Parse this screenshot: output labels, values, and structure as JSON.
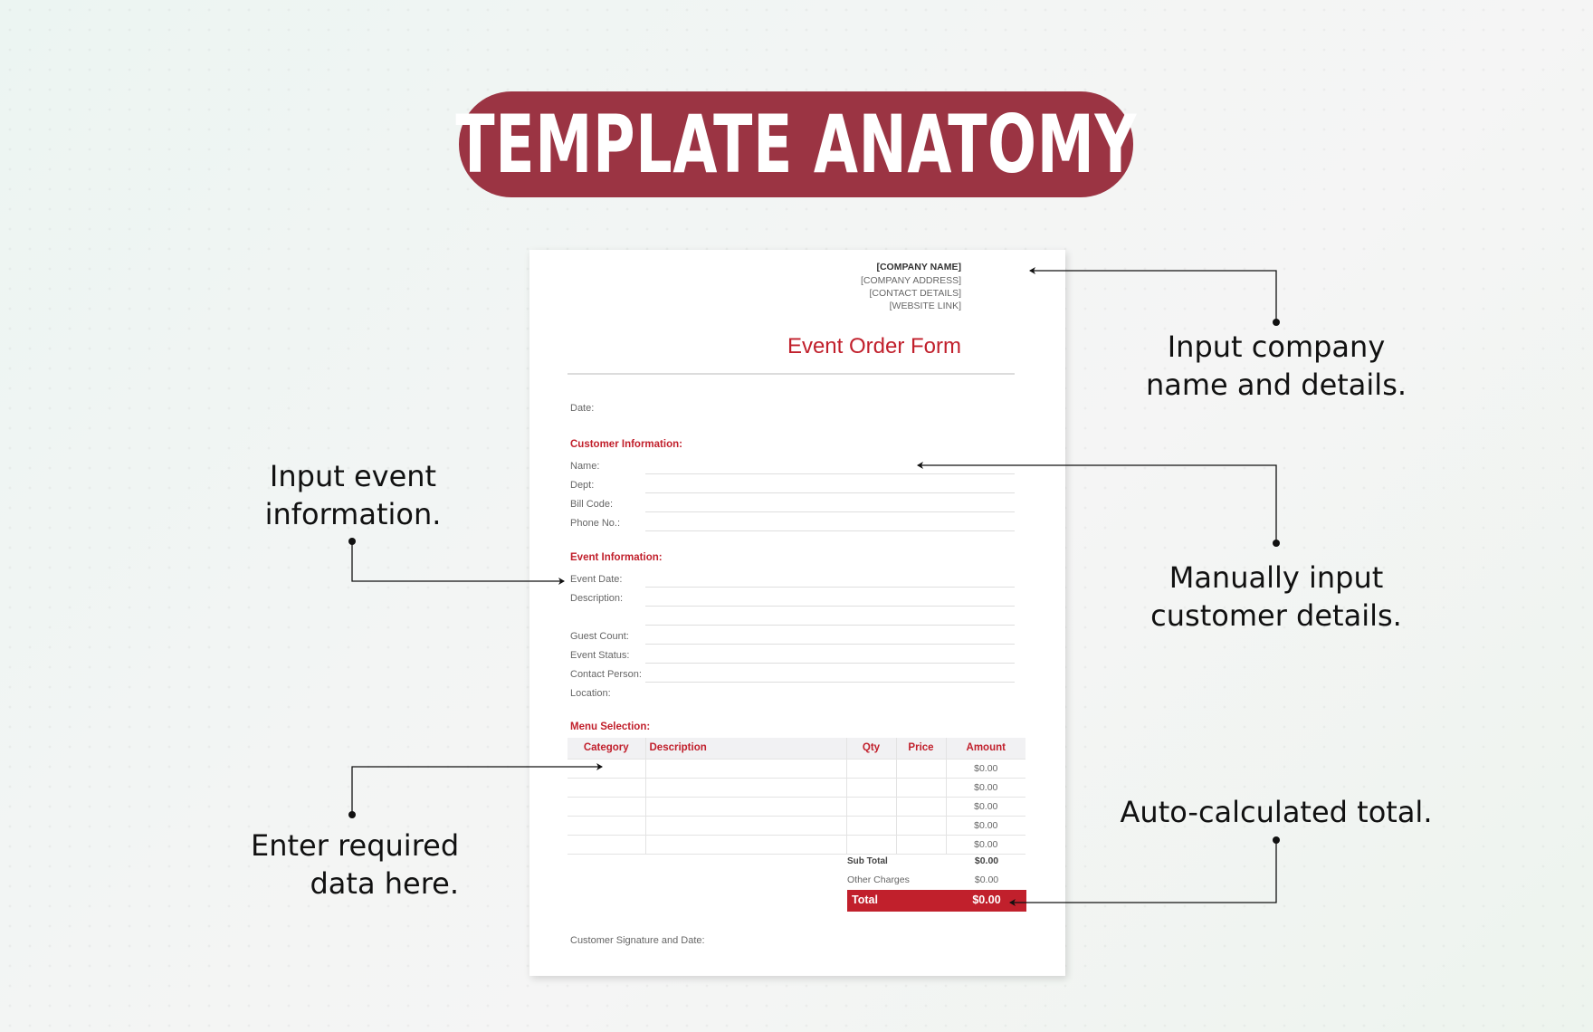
{
  "banner": {
    "title": "TEMPLATE ANATOMY",
    "color": "#9b3443"
  },
  "document": {
    "company": {
      "name": "[COMPANY NAME]",
      "address": "[COMPANY ADDRESS]",
      "contact": "[CONTACT DETAILS]",
      "website": "[WEBSITE LINK]"
    },
    "title": "Event Order Form",
    "accent_color": "#c1202c",
    "date_label": "Date:",
    "customer_section": {
      "heading": "Customer Information:",
      "fields": [
        "Name:",
        "Dept:",
        "Bill Code:",
        "Phone No.:"
      ]
    },
    "event_section": {
      "heading": "Event Information:",
      "fields": [
        "Event Date:",
        "Description:",
        "",
        "Guest Count:",
        "Event Status:",
        "Contact Person:",
        "Location:"
      ]
    },
    "menu_section": {
      "heading": "Menu Selection:",
      "columns": [
        "Category",
        "Description",
        "Qty",
        "Price",
        "Amount"
      ],
      "rows": [
        {
          "category": "",
          "description": "",
          "qty": "",
          "price": "",
          "amount": "$0.00"
        },
        {
          "category": "",
          "description": "",
          "qty": "",
          "price": "",
          "amount": "$0.00"
        },
        {
          "category": "",
          "description": "",
          "qty": "",
          "price": "",
          "amount": "$0.00"
        },
        {
          "category": "",
          "description": "",
          "qty": "",
          "price": "",
          "amount": "$0.00"
        },
        {
          "category": "",
          "description": "",
          "qty": "",
          "price": "",
          "amount": "$0.00"
        }
      ],
      "subtotal_label": "Sub Total",
      "subtotal_value": "$0.00",
      "other_label": "Other Charges",
      "other_value": "$0.00",
      "total_label": "Total",
      "total_value": "$0.00"
    },
    "signature_label": "Customer Signature and Date:"
  },
  "callouts": {
    "company": [
      "Input company",
      "name and details."
    ],
    "customer": [
      "Manually input",
      "customer details."
    ],
    "event": [
      "Input event",
      "information."
    ],
    "data": [
      "Enter required",
      "data here."
    ],
    "total": [
      "Auto-calculated total."
    ]
  }
}
